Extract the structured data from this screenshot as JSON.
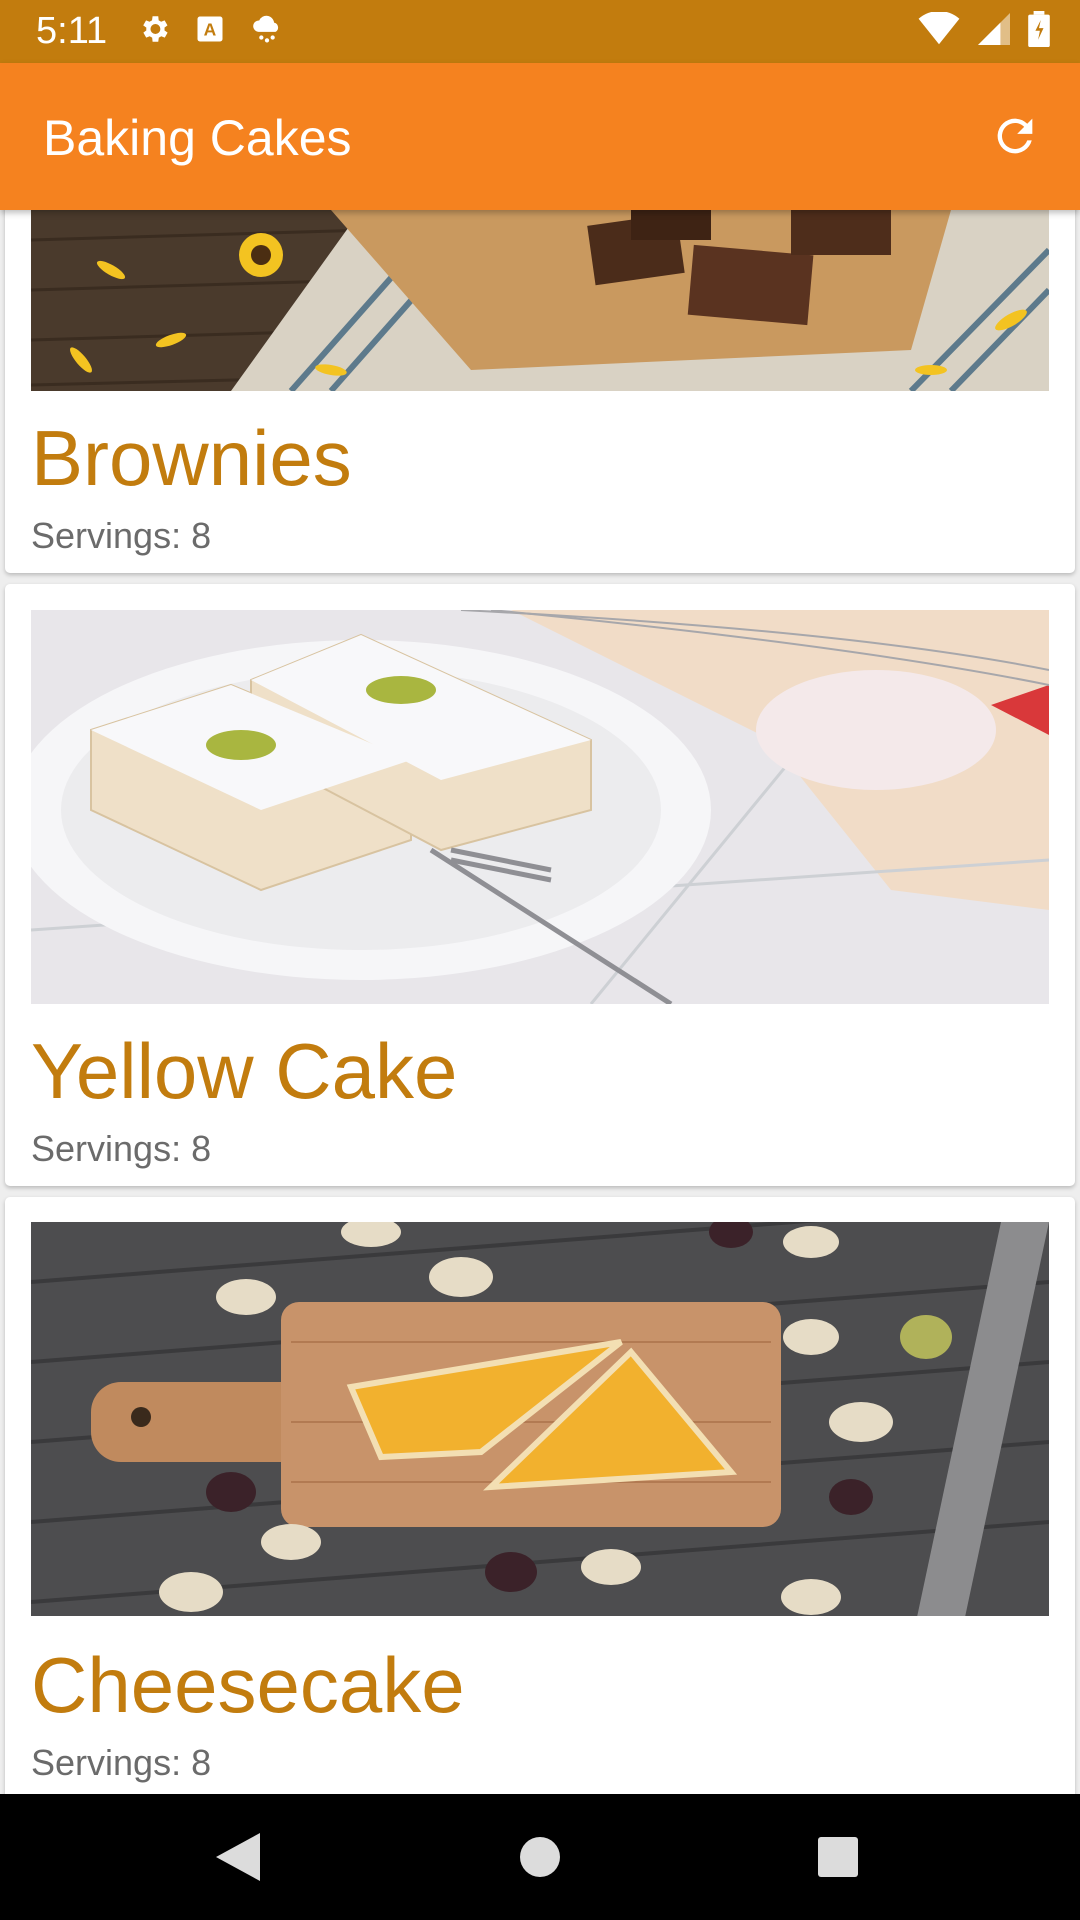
{
  "status_bar": {
    "time": "5:11",
    "left_icons": [
      "settings-icon",
      "keyboard-a-icon",
      "weather-icon"
    ],
    "right_icons": [
      "wifi-icon",
      "signal-icon",
      "battery-icon"
    ],
    "color": "#c27c0e"
  },
  "app_bar": {
    "title": "Baking Cakes",
    "action_icon": "refresh-icon",
    "color": "#f5821f"
  },
  "recipes": [
    {
      "name": "Brownies",
      "servings": "Servings: 8",
      "image": "brownies-photo"
    },
    {
      "name": "Yellow Cake",
      "servings": "Servings: 8",
      "image": "yellow-cake-photo"
    },
    {
      "name": "Cheesecake",
      "servings": "Servings: 8",
      "image": "cheesecake-photo"
    }
  ],
  "nav_bar": {
    "buttons": [
      "back-icon",
      "home-icon",
      "recents-icon"
    ]
  },
  "colors": {
    "title_text": "#c27c0e",
    "secondary_text": "#6b6b6b"
  }
}
